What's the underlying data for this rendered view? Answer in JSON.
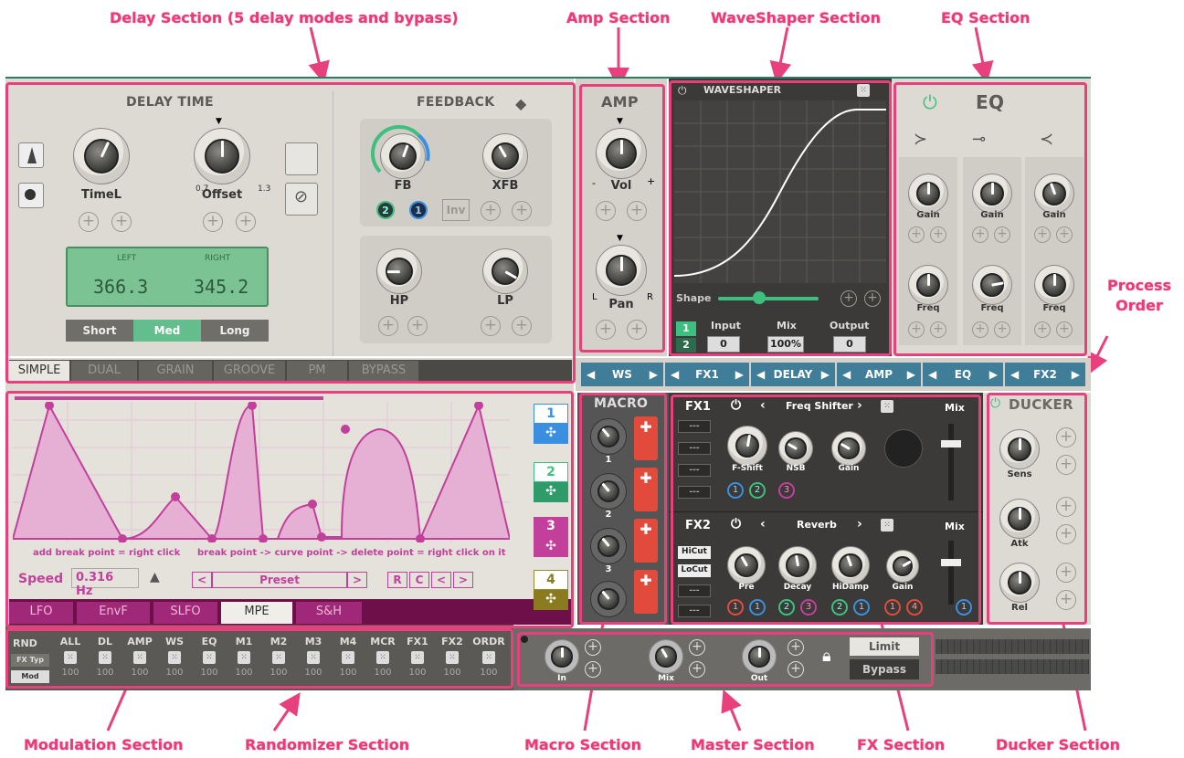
{
  "callouts": {
    "delay": "Delay Section (5 delay modes and bypass)",
    "amp": "Amp Section",
    "waveshaper": "WaveShaper Section",
    "eq": "EQ Section",
    "process_order": "Process\nOrder",
    "modulation": "Modulation Section",
    "randomizer": "Randomizer Section",
    "macro": "Macro Section",
    "master": "Master Section",
    "fx": "FX Section",
    "ducker": "Ducker Section"
  },
  "delay": {
    "time_header": "DELAY TIME",
    "feedback_header": "FEEDBACK",
    "timel": "TimeL",
    "offset": "Offset",
    "offset_min": "0.7",
    "offset_max": "1.3",
    "left_label": "LEFT",
    "right_label": "RIGHT",
    "left_value": "366.3",
    "right_value": "345.2",
    "ranges": [
      "Short",
      "Med",
      "Long"
    ],
    "fb": "FB",
    "xfb": "XFB",
    "hp": "HP",
    "lp": "LP",
    "inv": "Inv",
    "fb_mod1": "2",
    "fb_mod2": "1",
    "modes": [
      "SIMPLE",
      "DUAL",
      "GRAIN",
      "GROOVE",
      "PM",
      "BYPASS"
    ]
  },
  "amp": {
    "title": "AMP",
    "vol": "Vol",
    "pan": "Pan",
    "l": "L",
    "r": "R",
    "minus": "-",
    "plus": "+"
  },
  "waveshaper": {
    "title": "WAVESHAPER",
    "shape": "Shape",
    "input": "Input",
    "mix": "Mix",
    "output": "Output",
    "input_val": "0",
    "mix_val": "100%",
    "output_val": "0",
    "slot1": "1",
    "slot2": "2"
  },
  "eq": {
    "title": "EQ",
    "gain": "Gain",
    "freq": "Freq"
  },
  "process_order": [
    "WS",
    "FX1",
    "DELAY",
    "AMP",
    "EQ",
    "FX2"
  ],
  "modulation": {
    "hint1": "add break point = right click",
    "hint2": "break point -> curve point -> delete point = right click on it",
    "speed_label": "Speed",
    "speed_value": "0.316 Hz",
    "preset": "Preset",
    "r": "R",
    "c": "C",
    "tabs": [
      "LFO",
      "EnvF",
      "SLFO",
      "MPE",
      "S&H"
    ],
    "slots": [
      "1",
      "2",
      "3",
      "4"
    ]
  },
  "macro": {
    "title": "MACRO",
    "labels": [
      "1",
      "2",
      "3"
    ]
  },
  "fx": {
    "fx1": "FX1",
    "fx1_name": "Freq Shifter",
    "fx2": "FX2",
    "fx2_name": "Reverb",
    "mix": "Mix",
    "fshift": "F-Shift",
    "nsb": "NSB",
    "gain": "Gain",
    "dash": "---",
    "pre": "Pre",
    "decay": "Decay",
    "hidamp": "HiDamp",
    "hicut": "HiCut",
    "locut": "LoCut",
    "fx1_mods": [
      "1",
      "2",
      "3"
    ],
    "fx2_mods": [
      "1",
      "1",
      "2",
      "3",
      "2",
      "1",
      "1",
      "4",
      "1"
    ]
  },
  "ducker": {
    "title": "DUCKER",
    "sens": "Sens",
    "atk": "Atk",
    "rel": "Rel"
  },
  "randomizer": {
    "rnd": "RND",
    "fxtyp": "FX Typ",
    "mod": "Mod",
    "cols": [
      "ALL",
      "DL",
      "AMP",
      "WS",
      "EQ",
      "M1",
      "M2",
      "M3",
      "M4",
      "MCR",
      "FX1",
      "FX2",
      "ORDR"
    ],
    "vals": [
      "100",
      "100",
      "100",
      "100",
      "100",
      "100",
      "100",
      "100",
      "100",
      "100",
      "100",
      "100",
      "100"
    ]
  },
  "master": {
    "in": "In",
    "mix": "Mix",
    "out": "Out",
    "limit": "Limit",
    "bypass": "Bypass"
  },
  "colors": {
    "accent_pink": "#e8407c",
    "lcd_green": "#79c08f",
    "po_blue": "#3f7d98",
    "mod_purple": "#c2409c",
    "red_btn": "#e24b3c"
  }
}
